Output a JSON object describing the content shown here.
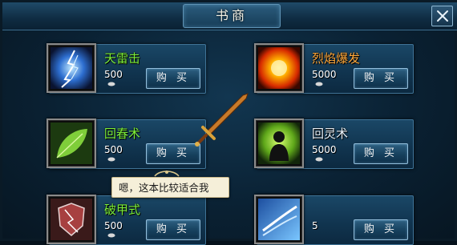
{
  "window": {
    "title": "书商"
  },
  "close_label": "✕",
  "skills": [
    {
      "name": "天雷击",
      "price": "500",
      "buy_label": "购 买",
      "name_color": "#7cf03a",
      "icon": "lightning-icon"
    },
    {
      "name": "烈焰爆发",
      "price": "5000",
      "buy_label": "购 买",
      "name_color": "#ffa83a",
      "icon": "flame-burst-icon"
    },
    {
      "name": "回春术",
      "price": "500",
      "buy_label": "购 买",
      "name_color": "#7cf03a",
      "icon": "leaf-icon"
    },
    {
      "name": "回灵术",
      "price": "5000",
      "buy_label": "购 买",
      "name_color": "#ffffff",
      "icon": "spirit-silhouette-icon"
    },
    {
      "name": "破甲式",
      "price": "500",
      "buy_label": "购 买",
      "name_color": "#7cf03a",
      "icon": "armor-break-icon"
    },
    {
      "name": "",
      "price": "5",
      "buy_label": "购 买",
      "name_color": "#ffffff",
      "icon": "wind-slash-icon"
    }
  ],
  "tooltip": {
    "text": "嗯，这本比较适合我"
  }
}
